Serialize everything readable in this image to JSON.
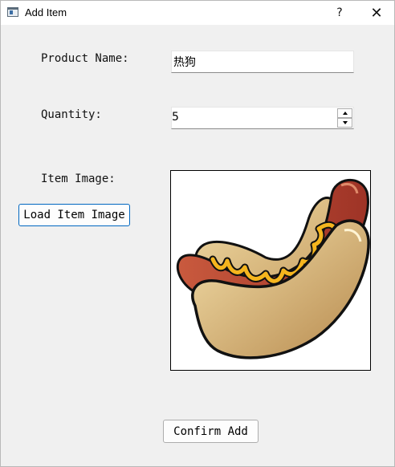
{
  "window": {
    "title": "Add Item",
    "help_glyph": "?",
    "close_glyph": "✕",
    "app_icon": "window-app-icon"
  },
  "form": {
    "product_name_label": "Product Name:",
    "product_name_value": "热狗",
    "quantity_label": "Quantity:",
    "quantity_value": "5",
    "item_image_label": "Item Image:",
    "load_image_button": "Load Item Image",
    "confirm_button": "Confirm Add"
  },
  "image_preview": {
    "subject": "hot-dog-image",
    "colors": {
      "bun_light": "#f3dfaa",
      "bun_dark": "#b78a4e",
      "sausage": "#a8392a",
      "sausage_light": "#c95a3e",
      "mustard": "#f5b51e",
      "outline": "#111111"
    }
  },
  "theme": {
    "accent": "#0067c0",
    "background": "#f0f0f0"
  }
}
